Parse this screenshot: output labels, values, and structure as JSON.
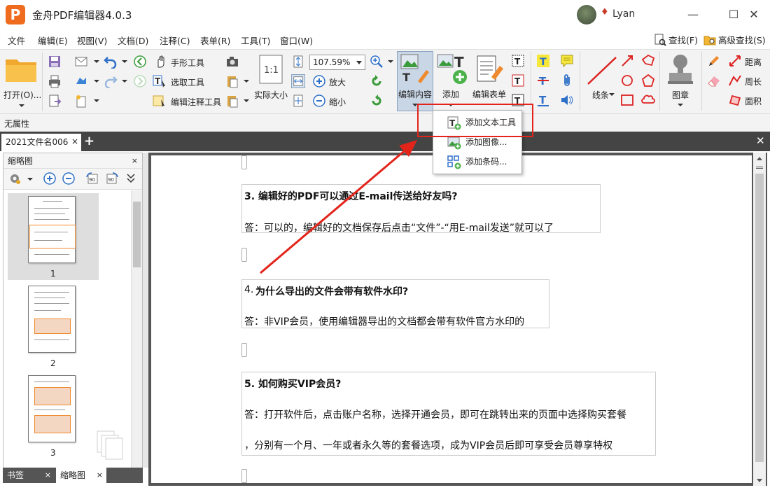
{
  "app": {
    "logo_letter": "P",
    "title": "金舟PDF编辑器4.0.3",
    "user": "Lyan"
  },
  "window_buttons": {
    "minimize": "—",
    "maximize": "☐",
    "close": "✕"
  },
  "menu": {
    "items": [
      "文件",
      "编辑(E)",
      "视图(V)",
      "文档(D)",
      "注释(C)",
      "表单(R)",
      "工具(T)",
      "窗口(W)"
    ],
    "find": "查找(F)",
    "advanced_find": "高级查找(S)"
  },
  "toolbar": {
    "open": "打开(O)...",
    "hand_tool": "手形工具",
    "select_tool": "选取工具",
    "edit_annot_tool": "编辑注释工具",
    "actual_size": "实际大小",
    "zoom_value": "107.59%",
    "zoom_in": "放大",
    "zoom_out": "缩小",
    "edit_content": "编辑内容",
    "add": "添加",
    "edit_form": "编辑表单",
    "lines": "线条",
    "stamp": "图章",
    "distance": "距离",
    "perimeter": "周长",
    "area": "面积"
  },
  "properties": {
    "label": "无属性"
  },
  "tabs": {
    "doc_tab": "2021文件名006",
    "close": "×",
    "add": "+",
    "close_all": "✕"
  },
  "left_panel": {
    "title": "缩略图",
    "close": "×",
    "pages": [
      "1",
      "2",
      "3"
    ],
    "bottom_tabs": [
      {
        "label": "书签",
        "close": "×"
      },
      {
        "label": "缩略图",
        "close": "×"
      }
    ]
  },
  "dropdown": {
    "items": [
      "添加文本工具",
      "添加图像...",
      "添加条码..."
    ]
  },
  "document": {
    "q3_title": "3. 编辑好的PDF可以通过E-mail传送给好友吗?",
    "q3_answer": "答：可以的，编辑好的文档保存后点击“文件”-“用E-mail发送”就可以了",
    "q4_num": "4.",
    "q4_title": "为什么导出的文件会带有软件水印?",
    "q4_answer": "答：非VIP会员，使用编辑器导出的文档都会带有软件官方水印的",
    "q5_title": "5. 如何购买VIP会员?",
    "q5_answer_1": "答：打开软件后，点击账户名称，选择开通会员，即可在跳转出来的页面中选择购买套餐",
    "q5_answer_2": "，分别有一个月、一年或者永久等的套餐选项，成为VIP会员后即可享受会员尊享特权"
  },
  "colors": {
    "accent_orange": "#ef6c1e",
    "highlight_red": "#e3241b",
    "tab_bar": "#444444"
  }
}
